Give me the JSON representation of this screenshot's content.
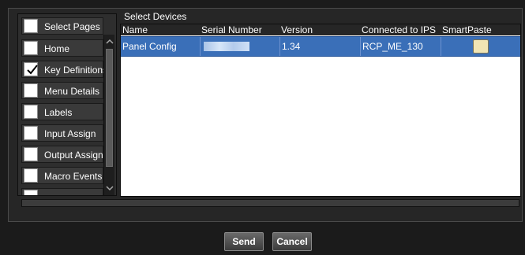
{
  "select_pages": {
    "items": [
      {
        "label": "Select Pages",
        "checked": false
      },
      {
        "label": "Home",
        "checked": false
      },
      {
        "label": "Key Definitions",
        "checked": true
      },
      {
        "label": "Menu Details",
        "checked": false
      },
      {
        "label": "Labels",
        "checked": false
      },
      {
        "label": "Input Assign",
        "checked": false
      },
      {
        "label": "Output Assign",
        "checked": false
      },
      {
        "label": "Macro Events",
        "checked": false
      },
      {
        "label": "",
        "checked": false
      }
    ]
  },
  "devices": {
    "title": "Select Devices",
    "columns": [
      "Name",
      "Serial Number",
      "Version",
      "Connected to IPS",
      "SmartPaste"
    ],
    "rows": [
      {
        "name": "Panel Config",
        "serial": "",
        "version": "1.34",
        "connected": "RCP_ME_130",
        "smartpaste": false
      }
    ]
  },
  "buttons": {
    "send": "Send",
    "cancel": "Cancel"
  },
  "colors": {
    "selection": "#3a6fb8",
    "toggle": "#f1e5b4"
  }
}
